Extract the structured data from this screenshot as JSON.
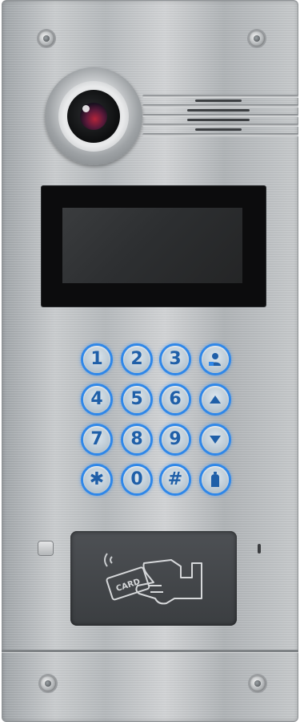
{
  "device": {
    "type": "door intercom panel"
  },
  "camera": {
    "icon": "camera-lens-icon"
  },
  "keypad": {
    "keys": [
      {
        "id": "1",
        "label": "1",
        "icon": "digit"
      },
      {
        "id": "2",
        "label": "2",
        "icon": "digit"
      },
      {
        "id": "3",
        "label": "3",
        "icon": "digit"
      },
      {
        "id": "user",
        "label": "",
        "icon": "user-icon"
      },
      {
        "id": "4",
        "label": "4",
        "icon": "digit"
      },
      {
        "id": "5",
        "label": "5",
        "icon": "digit"
      },
      {
        "id": "6",
        "label": "6",
        "icon": "digit"
      },
      {
        "id": "up",
        "label": "",
        "icon": "arrow-up-icon"
      },
      {
        "id": "7",
        "label": "7",
        "icon": "digit"
      },
      {
        "id": "8",
        "label": "8",
        "icon": "digit"
      },
      {
        "id": "9",
        "label": "9",
        "icon": "digit"
      },
      {
        "id": "down",
        "label": "",
        "icon": "arrow-down-icon"
      },
      {
        "id": "star",
        "label": "✱",
        "icon": "star-icon"
      },
      {
        "id": "0",
        "label": "0",
        "icon": "digit"
      },
      {
        "id": "hash",
        "label": "#",
        "icon": "hash-icon"
      },
      {
        "id": "bell",
        "label": "",
        "icon": "bell-icon"
      }
    ]
  },
  "card_reader": {
    "card_text": "CARD",
    "icon": "hand-card-icon"
  },
  "colors": {
    "key_glow": "#2f87e8",
    "key_text": "#1f5fa8",
    "reader": "#444749",
    "screen": "#0c0c0d"
  }
}
